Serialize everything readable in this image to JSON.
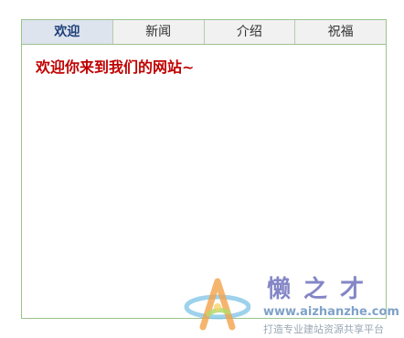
{
  "tabs": [
    {
      "label": "欢迎",
      "active": true
    },
    {
      "label": "新闻",
      "active": false
    },
    {
      "label": "介绍",
      "active": false
    },
    {
      "label": "祝福",
      "active": false
    }
  ],
  "panel": {
    "text": "欢迎你来到我们的网站~"
  },
  "watermark": {
    "title": "懒之才",
    "url": "www.aizhanzhe.com",
    "slogan": "打造专业建站资源共享平台"
  },
  "colors": {
    "border": "#9bc38c",
    "active_tab_bg": "#dde4ee",
    "active_tab_text": "#1e3f78",
    "panel_text": "#c00000"
  }
}
